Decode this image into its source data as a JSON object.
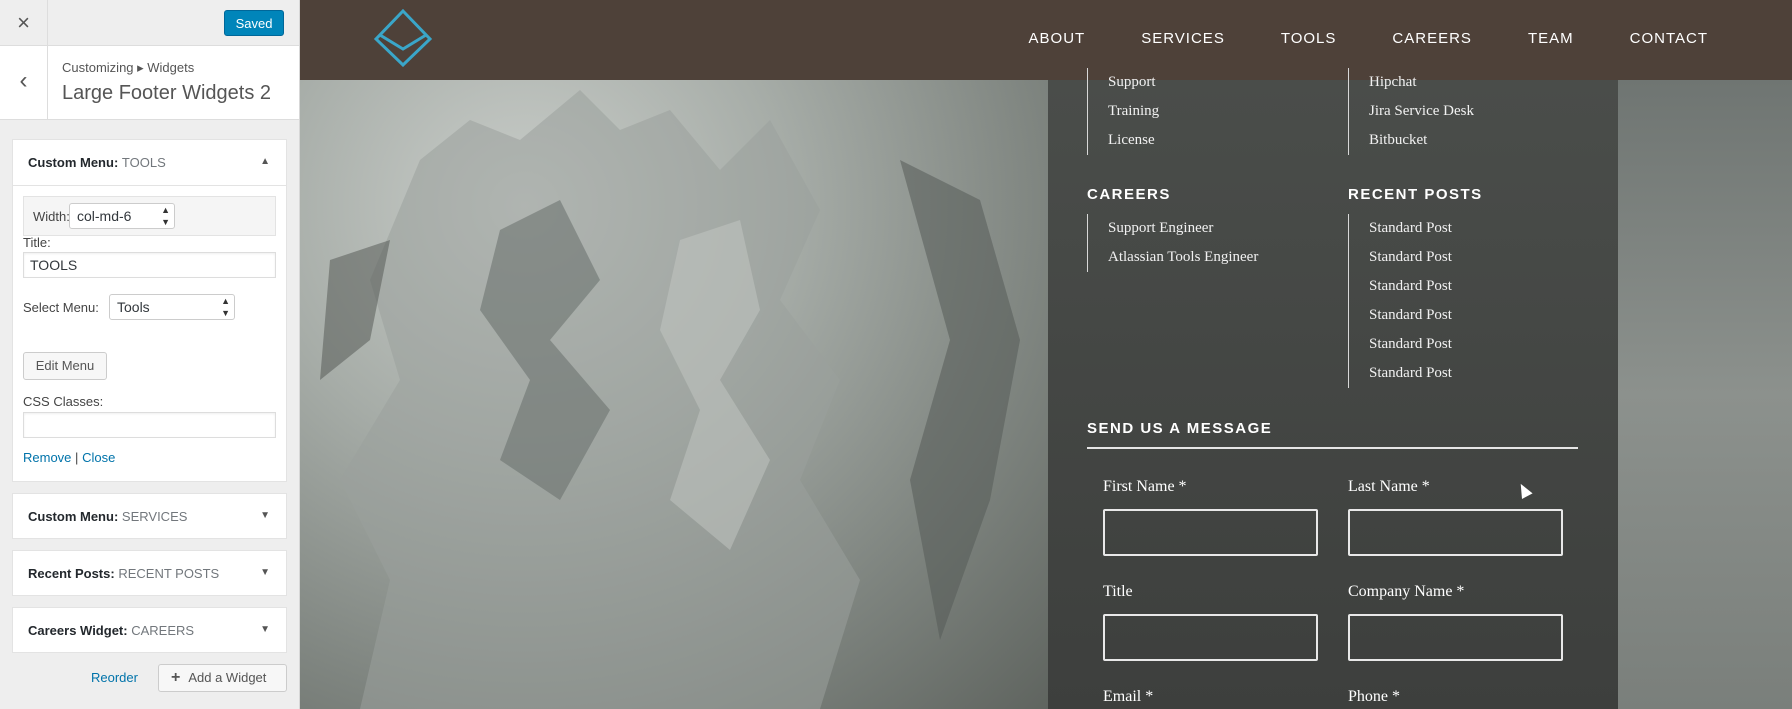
{
  "customizer": {
    "close_icon": "×",
    "saved_label": "Saved",
    "back_icon": "‹",
    "breadcrumb": "Customizing ▸ Widgets",
    "section_title": "Large Footer Widgets 2",
    "widgets": [
      {
        "type": "Custom Menu:",
        "name": "TOOLS",
        "expanded": true
      },
      {
        "type": "Custom Menu:",
        "name": "SERVICES",
        "expanded": false
      },
      {
        "type": "Recent Posts:",
        "name": "RECENT POSTS",
        "expanded": false
      },
      {
        "type": "Careers Widget:",
        "name": "CAREERS",
        "expanded": false
      }
    ],
    "form": {
      "width_label": "Width:",
      "width_value": "col-md-6",
      "title_label": "Title:",
      "title_value": "TOOLS",
      "select_menu_label": "Select Menu:",
      "select_menu_value": "Tools",
      "edit_menu_label": "Edit Menu",
      "css_classes_label": "CSS Classes:",
      "css_classes_value": "",
      "remove_label": "Remove",
      "separator": "|",
      "close_label": "Close"
    },
    "reorder_label": "Reorder",
    "add_widget_label": "Add a Widget"
  },
  "site": {
    "nav": [
      "ABOUT",
      "SERVICES",
      "TOOLS",
      "CAREERS",
      "TEAM",
      "CONTACT"
    ],
    "brand_color": "#3aa6c9",
    "footer": {
      "col1_items": [
        "Support",
        "Training",
        "License"
      ],
      "col2_items": [
        "Hipchat",
        "Jira Service Desk",
        "Bitbucket"
      ],
      "careers_heading": "CAREERS",
      "careers_items": [
        "Support Engineer",
        "Atlassian Tools Engineer"
      ],
      "recent_heading": "RECENT POSTS",
      "recent_items": [
        "Standard Post",
        "Standard Post",
        "Standard Post",
        "Standard Post",
        "Standard Post",
        "Standard Post"
      ],
      "message_heading": "SEND US A MESSAGE",
      "fields": {
        "first_name": "First Name *",
        "last_name": "Last Name *",
        "title": "Title",
        "company": "Company Name *",
        "email": "Email *",
        "phone": "Phone *"
      }
    }
  }
}
